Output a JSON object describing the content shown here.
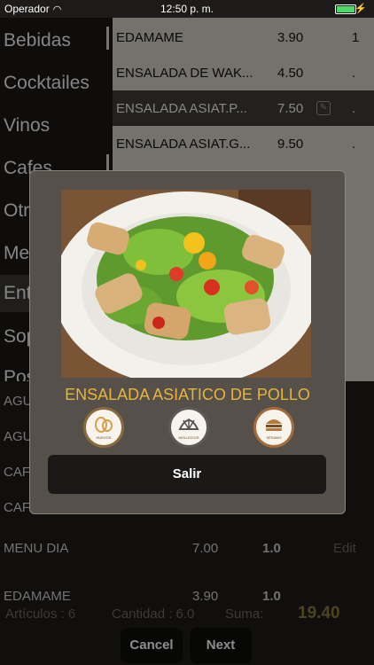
{
  "status_bar": {
    "carrier": "Operador",
    "time": "12:50 p. m."
  },
  "sidebar": {
    "items": [
      {
        "label": "Bebidas"
      },
      {
        "label": "Cocktailes"
      },
      {
        "label": "Vinos"
      },
      {
        "label": "Cafes"
      },
      {
        "label": "Otr"
      },
      {
        "label": "Me"
      },
      {
        "label": "Ent"
      },
      {
        "label": "Sop"
      },
      {
        "label": "Pos"
      }
    ]
  },
  "items_list": [
    {
      "name": "EDAMAME",
      "price": "3.90",
      "qty": "1"
    },
    {
      "name": "ENSALADA DE WAK...",
      "price": "4.50",
      "qty": "."
    },
    {
      "name": "ENSALADA ASIAT.P...",
      "price": "7.50",
      "qty": "."
    },
    {
      "name": "ENSALADA ASIAT.G...",
      "price": "9.50",
      "qty": "."
    }
  ],
  "lower_list": [
    "AGU",
    "AGU",
    "CAF",
    "CAF"
  ],
  "order": {
    "rows": [
      {
        "name": "MENU DIA",
        "price": "7.00",
        "qty": "1.0",
        "edit": "Edit"
      },
      {
        "name": "EDAMAME",
        "price": "3.90",
        "qty": "1.0"
      }
    ],
    "articulos": "Artículos : 6",
    "cantidad": "Cantidad : 6.0",
    "suma_label": "Suma:",
    "suma_value": "19.40"
  },
  "buttons": {
    "cancel": "Cancel",
    "next": "Next"
  },
  "modal": {
    "title": "ENSALADA ASIATICO DE POLLO",
    "allergens": [
      {
        "label": "HUEVOS",
        "icon": "egg-icon"
      },
      {
        "label": "MOLUSCOS",
        "icon": "shell-icon"
      },
      {
        "label": "SÉSAMO",
        "icon": "sesame-icon"
      }
    ],
    "exit_label": "Salir"
  },
  "colors": {
    "accent": "#e7b43c",
    "total": "#8d7a3b"
  }
}
